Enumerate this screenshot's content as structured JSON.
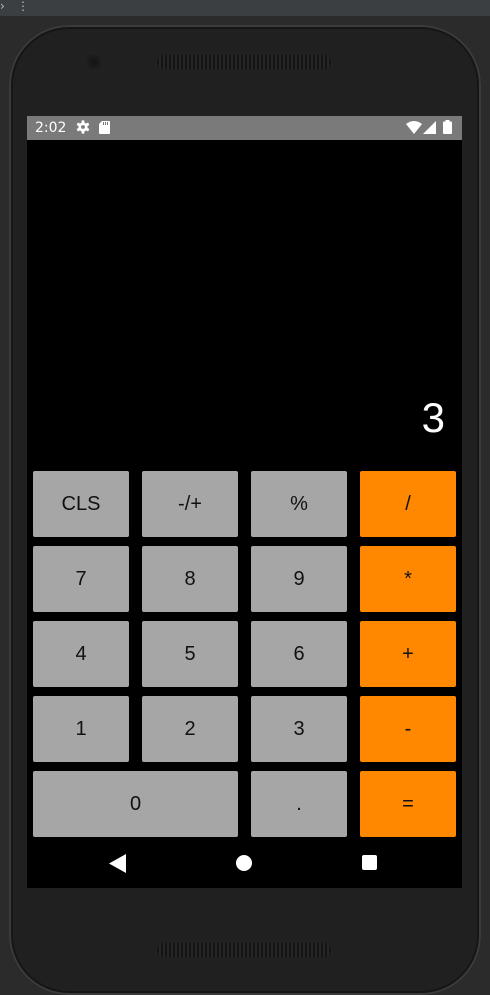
{
  "status_bar": {
    "time": "2:02"
  },
  "display": {
    "value": "3"
  },
  "keys": {
    "cls": "CLS",
    "sign": "-/+",
    "percent": "%",
    "divide": "/",
    "seven": "7",
    "eight": "8",
    "nine": "9",
    "multiply": "*",
    "four": "4",
    "five": "5",
    "six": "6",
    "plus": "+",
    "one": "1",
    "two": "2",
    "three": "3",
    "minus": "-",
    "zero": "0",
    "dot": ".",
    "equals": "="
  },
  "colors": {
    "number_key": "#a6a6a6",
    "operator_key": "#ff8800",
    "display_background": "#000000",
    "display_text": "#ffffff",
    "status_bar": "#7a7a7a"
  },
  "icons": {
    "status": [
      "gear-icon",
      "sd-card-icon",
      "wifi-icon",
      "signal-icon",
      "battery-icon"
    ],
    "navigation": [
      "back-icon",
      "home-icon",
      "recents-icon"
    ]
  }
}
